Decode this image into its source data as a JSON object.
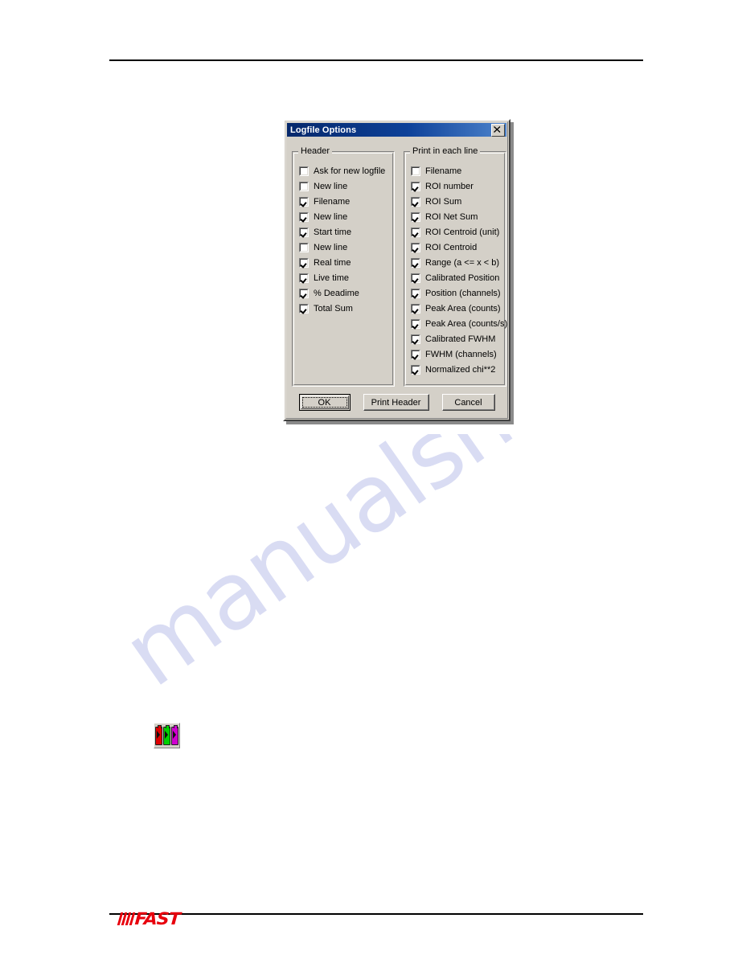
{
  "page": {
    "watermark_text": "manualshive"
  },
  "footer": {
    "logo_text": "FAST"
  },
  "toolbar_icon": {
    "name": "three-bottles-icon"
  },
  "dialog": {
    "title": "Logfile Options",
    "close_label": "×",
    "groups": [
      {
        "title": "Header",
        "items": [
          {
            "label": "Ask for new logfile",
            "checked": false
          },
          {
            "label": "New line",
            "checked": false
          },
          {
            "label": "Filename",
            "checked": true
          },
          {
            "label": "New line",
            "checked": true
          },
          {
            "label": "Start time",
            "checked": true
          },
          {
            "label": "New line",
            "checked": false
          },
          {
            "label": "Real time",
            "checked": true
          },
          {
            "label": "Live time",
            "checked": true
          },
          {
            "label": "% Deadime",
            "checked": true
          },
          {
            "label": "Total Sum",
            "checked": true
          }
        ]
      },
      {
        "title": "Print in each line",
        "items": [
          {
            "label": "Filename",
            "checked": false
          },
          {
            "label": "ROI number",
            "checked": true
          },
          {
            "label": "ROI Sum",
            "checked": true
          },
          {
            "label": "ROI Net Sum",
            "checked": true
          },
          {
            "label": "ROI Centroid (unit)",
            "checked": true
          },
          {
            "label": "ROI Centroid",
            "checked": true
          },
          {
            "label": "Range (a <= x < b)",
            "checked": true
          },
          {
            "label": "Calibrated Position",
            "checked": true
          },
          {
            "label": "Position (channels)",
            "checked": true
          },
          {
            "label": "Peak Area (counts)",
            "checked": true
          },
          {
            "label": "Peak Area (counts/s)",
            "checked": true
          },
          {
            "label": "Calibrated FWHM",
            "checked": true
          },
          {
            "label": "FWHM (channels)",
            "checked": true
          },
          {
            "label": "Normalized chi**2",
            "checked": true
          }
        ]
      }
    ],
    "buttons": {
      "ok": "OK",
      "print_header": "Print Header",
      "cancel": "Cancel"
    }
  }
}
